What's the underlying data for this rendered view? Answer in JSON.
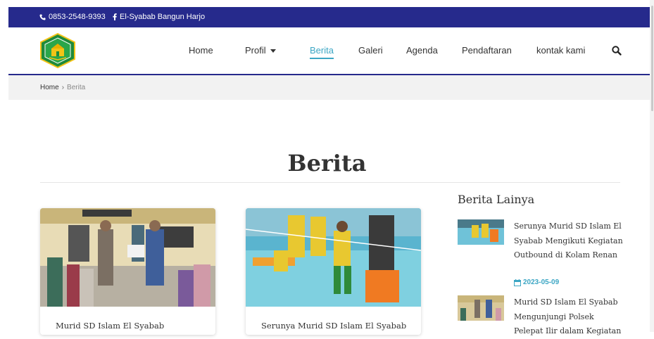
{
  "topbar": {
    "phone": "0853-2548-9393",
    "facebook": "El-Syabab Bangun Harjo",
    "icons": {
      "phone": "phone-icon",
      "facebook": "facebook-icon"
    }
  },
  "nav": {
    "items": [
      {
        "label": "Home"
      },
      {
        "label": "Profil"
      },
      {
        "label": "Berita"
      },
      {
        "label": "Galeri"
      },
      {
        "label": "Agenda"
      },
      {
        "label": "Pendaftaran"
      },
      {
        "label": "kontak kami"
      }
    ],
    "active": "Berita"
  },
  "breadcrumb": {
    "home": "Home",
    "separator": "›",
    "current": "Berita"
  },
  "page": {
    "title": "Berita"
  },
  "cards": [
    {
      "title": "Murid SD Islam El Syabab"
    },
    {
      "title": "Serunya Murid SD Islam El Syabab"
    }
  ],
  "sidebar": {
    "heading": "Berita Lainya",
    "items": [
      {
        "title": "Serunya Murid SD Islam El Syabab Mengikuti Kegiatan Outbound di Kolam Renan",
        "date": "2023-05-09"
      },
      {
        "title": "Murid SD Islam El Syabab Mengunjungi Polsek Pelepat Ilir dalam Kegiatan",
        "date": ""
      }
    ]
  },
  "colors": {
    "brand_navy": "#262a8c",
    "accent": "#3ca6c4"
  }
}
